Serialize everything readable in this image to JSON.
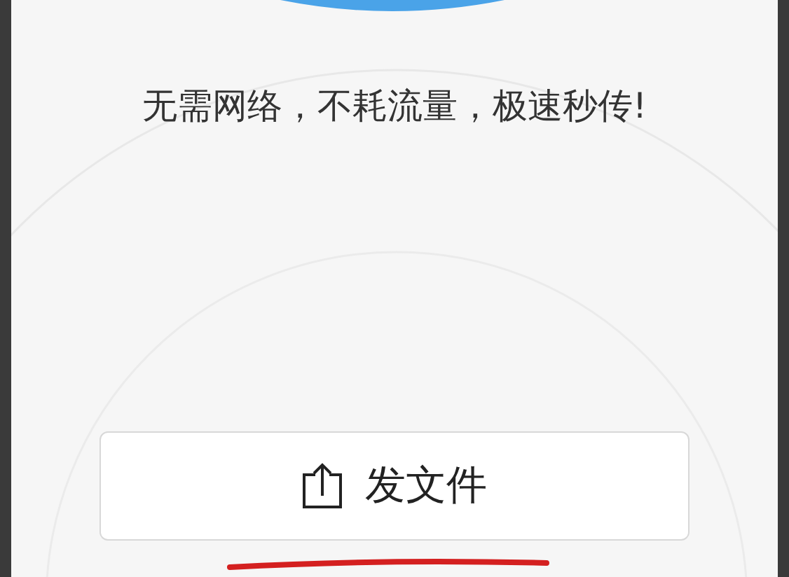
{
  "tagline": "无需网络，不耗流量，极速秒传!",
  "send_button": {
    "label": "发文件"
  }
}
